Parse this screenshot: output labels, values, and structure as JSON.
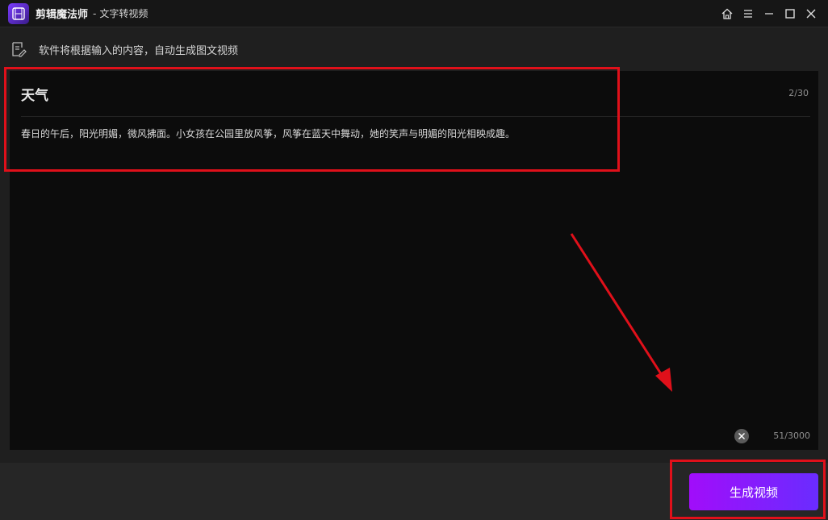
{
  "titlebar": {
    "app_name": "剪辑魔法师",
    "separator": "-",
    "window_title": "文字转视频",
    "icons": [
      "home-icon",
      "menu-icon",
      "minimize-icon",
      "maximize-icon",
      "close-icon"
    ]
  },
  "hint": {
    "icon": "note-edit-icon",
    "text": "软件将根据输入的内容，自动生成图文视频"
  },
  "editor": {
    "title_value": "天气",
    "title_count": "2/30",
    "body_value": "春日的午后，阳光明媚，微风拂面。小女孩在公园里放风筝，风筝在蓝天中舞动，她的笑声与明媚的阳光相映成趣。",
    "body_count": "51/3000",
    "clear_icon": "clear-icon"
  },
  "footer": {
    "generate_label": "生成视频"
  },
  "colors": {
    "accent_start": "#a10dfa",
    "accent_end": "#6a2cff",
    "annotation": "#e0101a",
    "background": "#1f1f1f",
    "editor_bg": "#0c0c0c"
  }
}
